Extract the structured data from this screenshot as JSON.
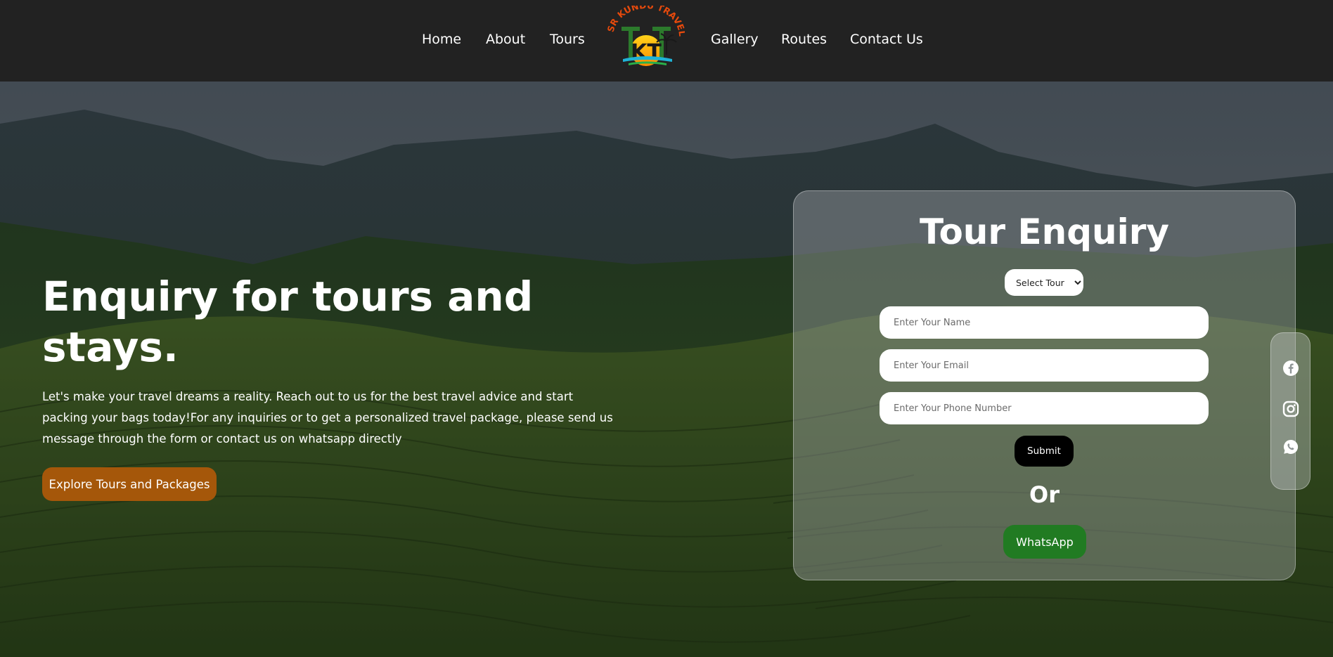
{
  "nav": {
    "links": [
      "Home",
      "About",
      "Tours",
      "Gallery",
      "Routes",
      "Contact Us"
    ],
    "logo_text": "SR KUNDU TRAVEL",
    "logo_letters": "KT"
  },
  "hero": {
    "title": "Enquiry for tours and stays.",
    "description": "Let's make your travel dreams a reality. Reach out to us for the best travel advice and start packing your bags today!For any inquiries or to get a personalized travel package, please send us message through the form or contact us on whatsapp directly",
    "cta_label": "Explore Tours and Packages"
  },
  "enquiry": {
    "title": "Tour Enquiry",
    "select_value": "Select Tour",
    "name_placeholder": "Enter Your Name",
    "email_placeholder": "Enter Your Email",
    "phone_placeholder": "Enter Your Phone Number",
    "submit_label": "Submit",
    "or_label": "Or",
    "whatsapp_label": "WhatsApp"
  },
  "social": {
    "icons": [
      "facebook-icon",
      "instagram-icon",
      "whatsapp-icon"
    ]
  },
  "colors": {
    "nav_bg": "#222222",
    "cta_bg": "#a5570a",
    "submit_bg": "#000000",
    "whatsapp_bg": "#217b22"
  }
}
